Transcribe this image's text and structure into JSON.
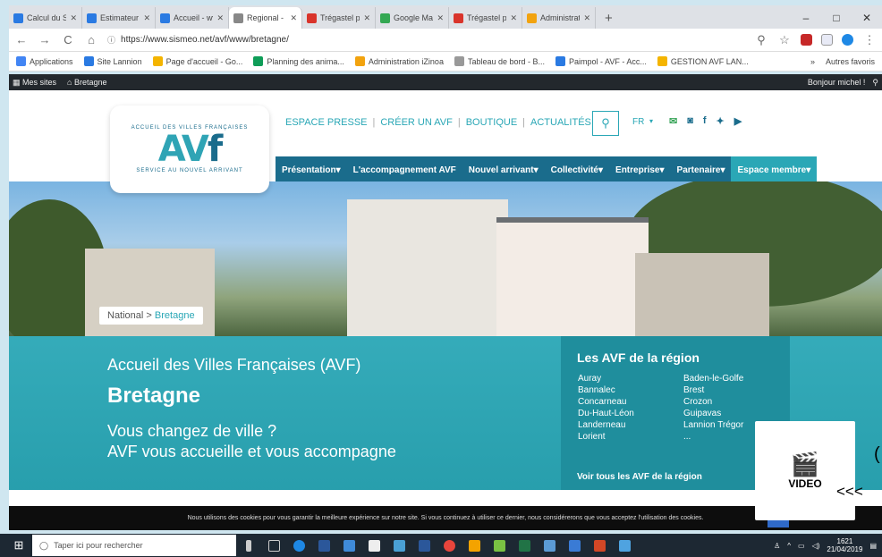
{
  "browser": {
    "tabs": [
      {
        "label": "Calcul du Sal",
        "color": "#2a7ae2"
      },
      {
        "label": "Estimateur",
        "color": "#2a7ae2"
      },
      {
        "label": "Accueil - www",
        "color": "#2a7ae2"
      },
      {
        "label": "Regional - Br",
        "color": "#888888",
        "active": true
      },
      {
        "label": "Trégastel plo",
        "color": "#d9342b"
      },
      {
        "label": "Google Maps",
        "color": "#34a853"
      },
      {
        "label": "Trégastel pla",
        "color": "#d9342b"
      },
      {
        "label": "Administratio",
        "color": "#f2a30f"
      }
    ],
    "newtab": "+",
    "window_controls": [
      "–",
      "□",
      "✕"
    ],
    "url": "https://www.sismeo.net/avf/www/bretagne/",
    "bookmarks": [
      {
        "label": "Applications",
        "color": "#4285f4"
      },
      {
        "label": "Site Lannion",
        "color": "#2a7ae2"
      },
      {
        "label": "Page d'accueil - Go...",
        "color": "#f4b400"
      },
      {
        "label": "Planning des anima...",
        "color": "#0f9d58"
      },
      {
        "label": "Administration iZinoa",
        "color": "#f2a30f"
      },
      {
        "label": "Tableau de bord - B...",
        "color": "#999999"
      },
      {
        "label": "Paimpol - AVF - Acc...",
        "color": "#2a7ae2"
      },
      {
        "label": "GESTION AVF LAN...",
        "color": "#f4b400"
      }
    ],
    "bookmarks_more": "»",
    "other_bookmarks": "Autres favoris"
  },
  "wpbar": {
    "sites": "Mes sites",
    "site": "Bretagne",
    "greeting": "Bonjour michel !"
  },
  "site": {
    "logo": {
      "top": "ACCUEIL DES VILLES FRANÇAISES",
      "bottom": "SERVICE AU NOUVEL ARRIVANT"
    },
    "toplinks": [
      "ESPACE PRESSE",
      "CRÉER UN AVF",
      "BOUTIQUE",
      "ACTUALITÉS"
    ],
    "lang": "FR",
    "menu": [
      "Présentation",
      "L'accompagnement AVF",
      "Nouvel arrivant",
      "Collectivité",
      "Entreprise",
      "Partenaire",
      "Espace membre"
    ],
    "breadcrumb": {
      "home": "National",
      "sep": ">",
      "current": "Bretagne"
    },
    "hero": {
      "title": "Accueil des Villes Françaises (AVF)",
      "region": "Bretagne",
      "line1": "Vous changez de ville ?",
      "line2": "AVF vous accueille et vous accompagne"
    },
    "avf_region": {
      "title": "Les AVF de la région",
      "col1": [
        "Auray",
        "Bannalec",
        "Concarneau",
        "Du-Haut-Léon",
        "Landerneau",
        "Lorient"
      ],
      "col2": [
        "Baden-le-Golfe",
        "Brest",
        "Crozon",
        "Guipavas",
        "Lannion Trégor",
        "..."
      ],
      "all": "Voir tous les AVF de la région"
    }
  },
  "cookie": "Nous utilisons des cookies pour vous garantir la meilleure expérience sur notre site. Si vous continuez à utiliser ce dernier, nous considérerons que vous acceptez l'utilisation des cookies.",
  "video": {
    "label": "VIDEO",
    "arrows": "<<<",
    "glyph": "("
  },
  "taskbar": {
    "search": "Taper ici pour rechercher",
    "time": "1621",
    "date": "21/04/2019"
  }
}
